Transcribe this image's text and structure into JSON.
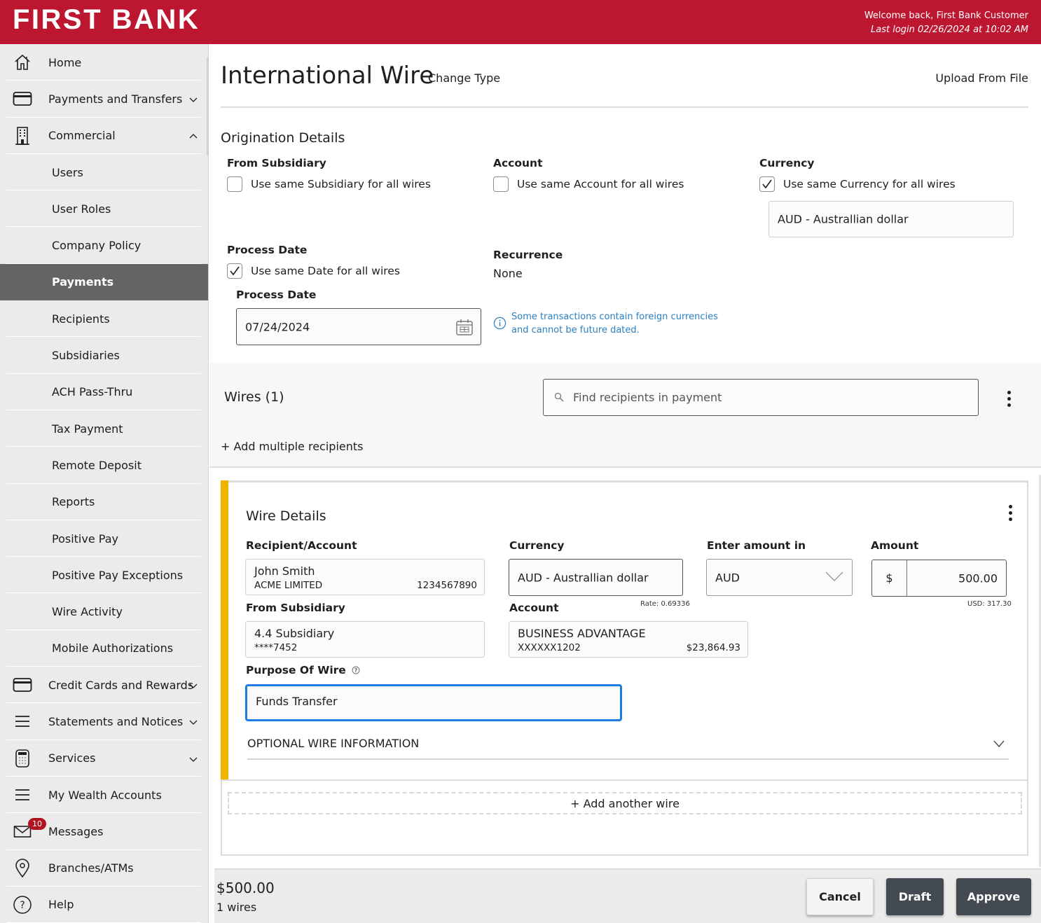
{
  "header": {
    "brand": "FIRST BANK",
    "welcome": "Welcome back, First Bank Customer",
    "last_login": "Last login 02/26/2024 at 10:02 AM",
    "brand_color": "#bd1630"
  },
  "sidebar": {
    "items": [
      {
        "label": "Home",
        "icon": "home-icon",
        "type": "top"
      },
      {
        "label": "Payments and Transfers",
        "icon": "card-icon",
        "type": "top",
        "chevron": "down"
      },
      {
        "label": "Commercial",
        "icon": "building-icon",
        "type": "top",
        "chevron": "up"
      },
      {
        "label": "Users",
        "type": "sub"
      },
      {
        "label": "User Roles",
        "type": "sub"
      },
      {
        "label": "Company Policy",
        "type": "sub"
      },
      {
        "label": "Payments",
        "type": "sub",
        "active": true
      },
      {
        "label": "Recipients",
        "type": "sub"
      },
      {
        "label": "Subsidiaries",
        "type": "sub"
      },
      {
        "label": "ACH Pass-Thru",
        "type": "sub"
      },
      {
        "label": "Tax Payment",
        "type": "sub"
      },
      {
        "label": "Remote Deposit",
        "type": "sub"
      },
      {
        "label": "Reports",
        "type": "sub"
      },
      {
        "label": "Positive Pay",
        "type": "sub"
      },
      {
        "label": "Positive Pay Exceptions",
        "type": "sub"
      },
      {
        "label": "Wire Activity",
        "type": "sub"
      },
      {
        "label": "Mobile Authorizations",
        "type": "sub"
      },
      {
        "label": "Credit Cards and Rewards",
        "icon": "card-icon",
        "type": "top",
        "chevron": "down"
      },
      {
        "label": "Statements and Notices",
        "icon": "menu-icon",
        "type": "top",
        "chevron": "down"
      },
      {
        "label": "Services",
        "icon": "calculator-icon",
        "type": "top",
        "chevron": "down"
      },
      {
        "label": "My Wealth Accounts",
        "icon": "menu-icon",
        "type": "top"
      },
      {
        "label": "Messages",
        "icon": "mail-icon",
        "type": "top",
        "badge": "10"
      },
      {
        "label": "Branches/ATMs",
        "icon": "location-pin-icon",
        "type": "top"
      },
      {
        "label": "Help",
        "icon": "help-icon",
        "type": "top"
      }
    ]
  },
  "page": {
    "title": "International Wire",
    "change_type": "Change Type",
    "upload": "Upload From File"
  },
  "origination": {
    "title": "Origination Details",
    "from_subsidiary": {
      "label": "From Subsidiary",
      "checkbox": "Use same Subsidiary for all wires",
      "checked": false
    },
    "account": {
      "label": "Account",
      "checkbox": "Use same Account for all wires",
      "checked": false
    },
    "currency": {
      "label": "Currency",
      "checkbox": "Use same Currency for all wires",
      "checked": true,
      "value": "AUD - Australlian dollar"
    },
    "process_date": {
      "label": "Process Date",
      "checkbox": "Use same Date for all wires",
      "checked": true,
      "field_label": "Process Date",
      "value": "07/24/2024"
    },
    "recurrence": {
      "label": "Recurrence",
      "value": "None"
    },
    "info_line1": "Some transactions contain foreign currencies",
    "info_line2": "and cannot be future dated."
  },
  "wires": {
    "title": "Wires (1)",
    "search_placeholder": "Find recipients in payment",
    "add_multiple": "+ Add multiple recipients"
  },
  "wire_details": {
    "title": "Wire Details",
    "recipient_label": "Recipient/Account",
    "recipient_name": "John Smith",
    "recipient_company": "ACME LIMITED",
    "recipient_account": "1234567890",
    "currency_label": "Currency",
    "currency_value": "AUD - Australlian dollar",
    "rate": "Rate: 0.69336",
    "enter_amount_label": "Enter amount in",
    "enter_amount_value": "AUD",
    "amount_label": "Amount",
    "amount_symbol": "$",
    "amount_value": "500.00",
    "usd_equiv": "USD: 317.30",
    "from_subsidiary_label": "From Subsidiary",
    "subsidiary_name": "4.4 Subsidiary",
    "subsidiary_account": "****7452",
    "account_label": "Account",
    "account_name": "BUSINESS ADVANTAGE",
    "account_number": "XXXXXX1202",
    "account_balance": "$23,864.93",
    "purpose_label": "Purpose Of Wire",
    "purpose_value": "Funds Transfer",
    "optional": "OPTIONAL WIRE INFORMATION",
    "add_another": "+ Add another wire",
    "accent_color": "#f0b400"
  },
  "footer": {
    "total": "$500.00",
    "count": "1 wires",
    "cancel": "Cancel",
    "draft": "Draft",
    "approve": "Approve"
  }
}
